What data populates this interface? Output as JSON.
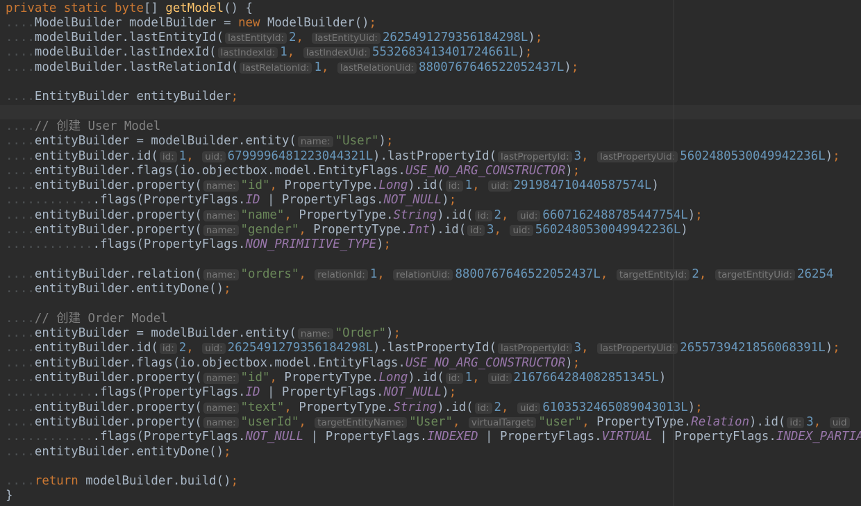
{
  "editor": {
    "lines": [
      [
        [
          "kw",
          "private static byte"
        ],
        [
          "t",
          "[] "
        ],
        [
          "fn",
          "getModel"
        ],
        [
          "t",
          "() {"
        ]
      ],
      [
        [
          "ws",
          "...."
        ],
        [
          "t",
          "ModelBuilder modelBuilder = "
        ],
        [
          "kw",
          "new "
        ],
        [
          "t",
          "ModelBuilder()"
        ],
        [
          "semi",
          ";"
        ]
      ],
      [
        [
          "ws",
          "...."
        ],
        [
          "t",
          "modelBuilder.lastEntityId("
        ],
        [
          "hint",
          "lastEntityId:"
        ],
        [
          "num",
          "2"
        ],
        [
          "kw",
          ", "
        ],
        [
          "hint",
          "lastEntityUid:"
        ],
        [
          "num",
          "2625491279356184298L"
        ],
        [
          "t",
          ")"
        ],
        [
          "semi",
          ";"
        ]
      ],
      [
        [
          "ws",
          "...."
        ],
        [
          "t",
          "modelBuilder.lastIndexId("
        ],
        [
          "hint",
          "lastIndexId:"
        ],
        [
          "num",
          "1"
        ],
        [
          "kw",
          ", "
        ],
        [
          "hint",
          "lastIndexUid:"
        ],
        [
          "num",
          "5532683413401724661L"
        ],
        [
          "t",
          ")"
        ],
        [
          "semi",
          ";"
        ]
      ],
      [
        [
          "ws",
          "...."
        ],
        [
          "t",
          "modelBuilder.lastRelationId("
        ],
        [
          "hint",
          "lastRelationId:"
        ],
        [
          "num",
          "1"
        ],
        [
          "kw",
          ", "
        ],
        [
          "hint",
          "lastRelationUid:"
        ],
        [
          "num",
          "8800767646522052437L"
        ],
        [
          "t",
          ")"
        ],
        [
          "semi",
          ";"
        ]
      ],
      [],
      [
        [
          "ws",
          "...."
        ],
        [
          "t",
          "EntityBuilder entityBuilder"
        ],
        [
          "semi",
          ";"
        ]
      ],
      [],
      [
        [
          "ws",
          "...."
        ],
        [
          "cm",
          "// 创建 User Model"
        ]
      ],
      [
        [
          "ws",
          "...."
        ],
        [
          "t",
          "entityBuilder = modelBuilder.entity("
        ],
        [
          "hint",
          "name:"
        ],
        [
          "str",
          "\"User\""
        ],
        [
          "t",
          ")"
        ],
        [
          "semi",
          ";"
        ]
      ],
      [
        [
          "ws",
          "...."
        ],
        [
          "t",
          "entityBuilder.id("
        ],
        [
          "hint",
          "id:"
        ],
        [
          "num",
          "1"
        ],
        [
          "kw",
          ", "
        ],
        [
          "hint",
          "uid:"
        ],
        [
          "num",
          "6799996481223044321L"
        ],
        [
          "t",
          ").lastPropertyId("
        ],
        [
          "hint",
          "lastPropertyId:"
        ],
        [
          "num",
          "3"
        ],
        [
          "kw",
          ", "
        ],
        [
          "hint",
          "lastPropertyUid:"
        ],
        [
          "num",
          "5602480530049942236L"
        ],
        [
          "t",
          ")"
        ],
        [
          "semi",
          ";"
        ]
      ],
      [
        [
          "ws",
          "...."
        ],
        [
          "t",
          "entityBuilder.flags(io.objectbox.model.EntityFlags."
        ],
        [
          "cst",
          "USE_NO_ARG_CONSTRUCTOR"
        ],
        [
          "t",
          ")"
        ],
        [
          "semi",
          ";"
        ]
      ],
      [
        [
          "ws",
          "...."
        ],
        [
          "t",
          "entityBuilder.property("
        ],
        [
          "hint",
          "name:"
        ],
        [
          "str",
          "\"id\""
        ],
        [
          "kw",
          ", "
        ],
        [
          "t",
          "PropertyType."
        ],
        [
          "cst",
          "Long"
        ],
        [
          "t",
          ").id("
        ],
        [
          "hint",
          "id:"
        ],
        [
          "num",
          "1"
        ],
        [
          "kw",
          ", "
        ],
        [
          "hint",
          "uid:"
        ],
        [
          "num",
          "291984710440587574L"
        ],
        [
          "t",
          ")"
        ]
      ],
      [
        [
          "ws",
          "............"
        ],
        [
          "t",
          ".flags(PropertyFlags."
        ],
        [
          "cst",
          "ID"
        ],
        [
          "t",
          " | PropertyFlags."
        ],
        [
          "cst",
          "NOT_NULL"
        ],
        [
          "t",
          ")"
        ],
        [
          "semi",
          ";"
        ]
      ],
      [
        [
          "ws",
          "...."
        ],
        [
          "t",
          "entityBuilder.property("
        ],
        [
          "hint",
          "name:"
        ],
        [
          "str",
          "\"name\""
        ],
        [
          "kw",
          ", "
        ],
        [
          "t",
          "PropertyType."
        ],
        [
          "cst",
          "String"
        ],
        [
          "t",
          ").id("
        ],
        [
          "hint",
          "id:"
        ],
        [
          "num",
          "2"
        ],
        [
          "kw",
          ", "
        ],
        [
          "hint",
          "uid:"
        ],
        [
          "num",
          "6607162488785447754L"
        ],
        [
          "t",
          ")"
        ],
        [
          "semi",
          ";"
        ]
      ],
      [
        [
          "ws",
          "...."
        ],
        [
          "t",
          "entityBuilder.property("
        ],
        [
          "hint",
          "name:"
        ],
        [
          "str",
          "\"gender\""
        ],
        [
          "kw",
          ", "
        ],
        [
          "t",
          "PropertyType."
        ],
        [
          "cst",
          "Int"
        ],
        [
          "t",
          ").id("
        ],
        [
          "hint",
          "id:"
        ],
        [
          "num",
          "3"
        ],
        [
          "kw",
          ", "
        ],
        [
          "hint",
          "uid:"
        ],
        [
          "num",
          "5602480530049942236L"
        ],
        [
          "t",
          ")"
        ]
      ],
      [
        [
          "ws",
          "............"
        ],
        [
          "t",
          ".flags(PropertyFlags."
        ],
        [
          "cst",
          "NON_PRIMITIVE_TYPE"
        ],
        [
          "t",
          ")"
        ],
        [
          "semi",
          ";"
        ]
      ],
      [],
      [
        [
          "ws",
          "...."
        ],
        [
          "t",
          "entityBuilder.relation("
        ],
        [
          "hint",
          "name:"
        ],
        [
          "str",
          "\"orders\""
        ],
        [
          "kw",
          ", "
        ],
        [
          "hint",
          "relationId:"
        ],
        [
          "num",
          "1"
        ],
        [
          "kw",
          ", "
        ],
        [
          "hint",
          "relationUid:"
        ],
        [
          "num",
          "8800767646522052437L"
        ],
        [
          "kw",
          ", "
        ],
        [
          "hint",
          "targetEntityId:"
        ],
        [
          "num",
          "2"
        ],
        [
          "kw",
          ", "
        ],
        [
          "hint",
          "targetEntityUid:"
        ],
        [
          "num",
          "26254"
        ]
      ],
      [
        [
          "ws",
          "...."
        ],
        [
          "t",
          "entityBuilder.entityDone()"
        ],
        [
          "semi",
          ";"
        ]
      ],
      [],
      [
        [
          "ws",
          "...."
        ],
        [
          "cm",
          "// 创建 Order Model"
        ]
      ],
      [
        [
          "ws",
          "...."
        ],
        [
          "t",
          "entityBuilder = modelBuilder.entity("
        ],
        [
          "hint",
          "name:"
        ],
        [
          "str",
          "\"Order\""
        ],
        [
          "t",
          ")"
        ],
        [
          "semi",
          ";"
        ]
      ],
      [
        [
          "ws",
          "...."
        ],
        [
          "t",
          "entityBuilder.id("
        ],
        [
          "hint",
          "id:"
        ],
        [
          "num",
          "2"
        ],
        [
          "kw",
          ", "
        ],
        [
          "hint",
          "uid:"
        ],
        [
          "num",
          "2625491279356184298L"
        ],
        [
          "t",
          ").lastPropertyId("
        ],
        [
          "hint",
          "lastPropertyId:"
        ],
        [
          "num",
          "3"
        ],
        [
          "kw",
          ", "
        ],
        [
          "hint",
          "lastPropertyUid:"
        ],
        [
          "num",
          "2655739421856068391L"
        ],
        [
          "t",
          ")"
        ],
        [
          "semi",
          ";"
        ]
      ],
      [
        [
          "ws",
          "...."
        ],
        [
          "t",
          "entityBuilder.flags(io.objectbox.model.EntityFlags."
        ],
        [
          "cst",
          "USE_NO_ARG_CONSTRUCTOR"
        ],
        [
          "t",
          ")"
        ],
        [
          "semi",
          ";"
        ]
      ],
      [
        [
          "ws",
          "...."
        ],
        [
          "t",
          "entityBuilder.property("
        ],
        [
          "hint",
          "name:"
        ],
        [
          "str",
          "\"id\""
        ],
        [
          "kw",
          ", "
        ],
        [
          "t",
          "PropertyType."
        ],
        [
          "cst",
          "Long"
        ],
        [
          "t",
          ").id("
        ],
        [
          "hint",
          "id:"
        ],
        [
          "num",
          "1"
        ],
        [
          "kw",
          ", "
        ],
        [
          "hint",
          "uid:"
        ],
        [
          "num",
          "2167664284082851345L"
        ],
        [
          "t",
          ")"
        ]
      ],
      [
        [
          "ws",
          "............"
        ],
        [
          "t",
          ".flags(PropertyFlags."
        ],
        [
          "cst",
          "ID"
        ],
        [
          "t",
          " | PropertyFlags."
        ],
        [
          "cst",
          "NOT_NULL"
        ],
        [
          "t",
          ")"
        ],
        [
          "semi",
          ";"
        ]
      ],
      [
        [
          "ws",
          "...."
        ],
        [
          "t",
          "entityBuilder.property("
        ],
        [
          "hint",
          "name:"
        ],
        [
          "str",
          "\"text\""
        ],
        [
          "kw",
          ", "
        ],
        [
          "t",
          "PropertyType."
        ],
        [
          "cst",
          "String"
        ],
        [
          "t",
          ").id("
        ],
        [
          "hint",
          "id:"
        ],
        [
          "num",
          "2"
        ],
        [
          "kw",
          ", "
        ],
        [
          "hint",
          "uid:"
        ],
        [
          "num",
          "6103532465089043013L"
        ],
        [
          "t",
          ")"
        ],
        [
          "semi",
          ";"
        ]
      ],
      [
        [
          "ws",
          "...."
        ],
        [
          "t",
          "entityBuilder.property("
        ],
        [
          "hint",
          "name:"
        ],
        [
          "str",
          "\"userId\""
        ],
        [
          "kw",
          ", "
        ],
        [
          "hint",
          "targetEntityName:"
        ],
        [
          "str",
          "\"User\""
        ],
        [
          "kw",
          ", "
        ],
        [
          "hint",
          "virtualTarget:"
        ],
        [
          "str",
          "\"user\""
        ],
        [
          "kw",
          ", "
        ],
        [
          "t",
          "PropertyType."
        ],
        [
          "cst",
          "Relation"
        ],
        [
          "t",
          ").id("
        ],
        [
          "hint",
          "id:"
        ],
        [
          "num",
          "3"
        ],
        [
          "kw",
          ", "
        ],
        [
          "hint",
          "uid"
        ]
      ],
      [
        [
          "ws",
          "............"
        ],
        [
          "t",
          ".flags(PropertyFlags."
        ],
        [
          "cst",
          "NOT_NULL"
        ],
        [
          "t",
          " | PropertyFlags."
        ],
        [
          "cst",
          "INDEXED"
        ],
        [
          "t",
          " | PropertyFlags."
        ],
        [
          "cst",
          "VIRTUAL"
        ],
        [
          "t",
          " | PropertyFlags."
        ],
        [
          "cst",
          "INDEX_PARTIAL_SKI"
        ]
      ],
      [
        [
          "ws",
          "...."
        ],
        [
          "t",
          "entityBuilder.entityDone()"
        ],
        [
          "semi",
          ";"
        ]
      ],
      [],
      [
        [
          "ws",
          "...."
        ],
        [
          "kw",
          "return "
        ],
        [
          "t",
          "modelBuilder.build()"
        ],
        [
          "semi",
          ";"
        ]
      ],
      [
        [
          "t",
          "}"
        ]
      ]
    ],
    "current_line": 7
  },
  "theme": {
    "background": "#2b2b2b",
    "default_text": "#a9b7c6",
    "keyword": "#cc7832",
    "method": "#ffc66d",
    "string": "#6a8759",
    "number": "#6897bb",
    "comment": "#808080",
    "constant": "#9876aa",
    "hint_bg": "#3b3b3b",
    "hint_text": "#787878"
  }
}
